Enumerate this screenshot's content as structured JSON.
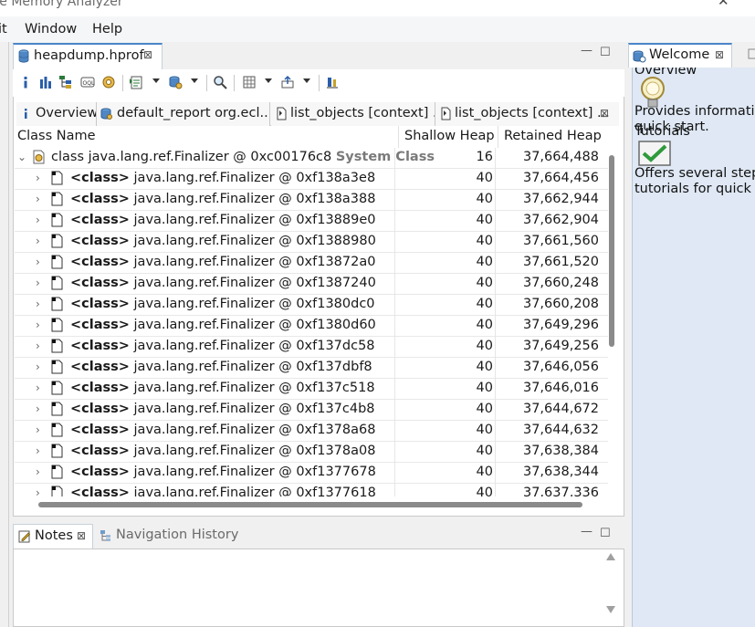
{
  "window": {
    "title": "se Memory Analyzer",
    "close_glyph": "✕"
  },
  "menu": {
    "items": [
      "it",
      "Window",
      "Help"
    ]
  },
  "editor": {
    "tab_label": "heapdump.hprof",
    "tab_icon": "database-icon",
    "close_glyph": "⊠",
    "minimize_glyph": "—",
    "maximize_glyph": "☐"
  },
  "toolbar": {
    "icons": [
      "info-icon",
      "histogram-icon",
      "dominator-tree-icon",
      "oql-icon",
      "thread-overview-icon",
      "report-icon",
      "query-browser-icon",
      "search-icon",
      "calculator-icon",
      "export-icon",
      "pin-icon"
    ]
  },
  "subtabs": [
    {
      "label": "Overview",
      "icon": "info-icon",
      "close": ""
    },
    {
      "label": "default_report  org.ecl...",
      "icon": "report-icon",
      "close": ""
    },
    {
      "label": "list_objects [context] ...",
      "icon": "document-icon",
      "close": ""
    },
    {
      "label": "list_objects [context]  ...",
      "icon": "document-icon",
      "close": "⊠"
    }
  ],
  "table": {
    "columns": [
      "Class Name",
      "Shallow Heap",
      "Retained Heap"
    ],
    "root": {
      "name": "class java.lang.ref.Finalizer @ 0xc00176c8",
      "suffix": "System Class",
      "shallow": "16",
      "retained": "37,664,488"
    },
    "rows": [
      {
        "prefix": "<class>",
        "name": "java.lang.ref.Finalizer @ 0xf138a3e8",
        "shallow": "40",
        "retained": "37,664,456"
      },
      {
        "prefix": "<class>",
        "name": "java.lang.ref.Finalizer @ 0xf138a388",
        "shallow": "40",
        "retained": "37,662,944"
      },
      {
        "prefix": "<class>",
        "name": "java.lang.ref.Finalizer @ 0xf13889e0",
        "shallow": "40",
        "retained": "37,662,904"
      },
      {
        "prefix": "<class>",
        "name": "java.lang.ref.Finalizer @ 0xf1388980",
        "shallow": "40",
        "retained": "37,661,560"
      },
      {
        "prefix": "<class>",
        "name": "java.lang.ref.Finalizer @ 0xf13872a0",
        "shallow": "40",
        "retained": "37,661,520"
      },
      {
        "prefix": "<class>",
        "name": "java.lang.ref.Finalizer @ 0xf1387240",
        "shallow": "40",
        "retained": "37,660,248"
      },
      {
        "prefix": "<class>",
        "name": "java.lang.ref.Finalizer @ 0xf1380dc0",
        "shallow": "40",
        "retained": "37,660,208"
      },
      {
        "prefix": "<class>",
        "name": "java.lang.ref.Finalizer @ 0xf1380d60",
        "shallow": "40",
        "retained": "37,649,296"
      },
      {
        "prefix": "<class>",
        "name": "java.lang.ref.Finalizer @ 0xf137dc58",
        "shallow": "40",
        "retained": "37,649,256"
      },
      {
        "prefix": "<class>",
        "name": "java.lang.ref.Finalizer @ 0xf137dbf8",
        "shallow": "40",
        "retained": "37,646,056"
      },
      {
        "prefix": "<class>",
        "name": "java.lang.ref.Finalizer @ 0xf137c518",
        "shallow": "40",
        "retained": "37,646,016"
      },
      {
        "prefix": "<class>",
        "name": "java.lang.ref.Finalizer @ 0xf137c4b8",
        "shallow": "40",
        "retained": "37,644,672"
      },
      {
        "prefix": "<class>",
        "name": "java.lang.ref.Finalizer @ 0xf1378a68",
        "shallow": "40",
        "retained": "37,644,632"
      },
      {
        "prefix": "<class>",
        "name": "java.lang.ref.Finalizer @ 0xf1378a08",
        "shallow": "40",
        "retained": "37,638,384"
      },
      {
        "prefix": "<class>",
        "name": "java.lang.ref.Finalizer @ 0xf1377678",
        "shallow": "40",
        "retained": "37,638,344"
      },
      {
        "prefix": "<class>",
        "name": "java.lang.ref.Finalizer @ 0xf1377618",
        "shallow": "40",
        "retained": "37,637,336"
      }
    ]
  },
  "notes": {
    "tab_label": "Notes",
    "nav_label": "Navigation History",
    "close_glyph": "⊠",
    "minimize_glyph": "—",
    "maximize_glyph": "☐"
  },
  "welcome": {
    "tab_label": "Welcome",
    "close_glyph": "⊠",
    "items": [
      {
        "title": "Overview",
        "desc_lines": [
          "Provides information",
          "quick start."
        ]
      },
      {
        "title": "Tutorials",
        "desc_lines": [
          "Offers several step-b",
          "tutorials for quick ac"
        ]
      }
    ]
  },
  "colors": {
    "accent": "#4a86c8",
    "welcome_bg": "#dfe8f4",
    "scrollbar": "#8a8a8a"
  }
}
